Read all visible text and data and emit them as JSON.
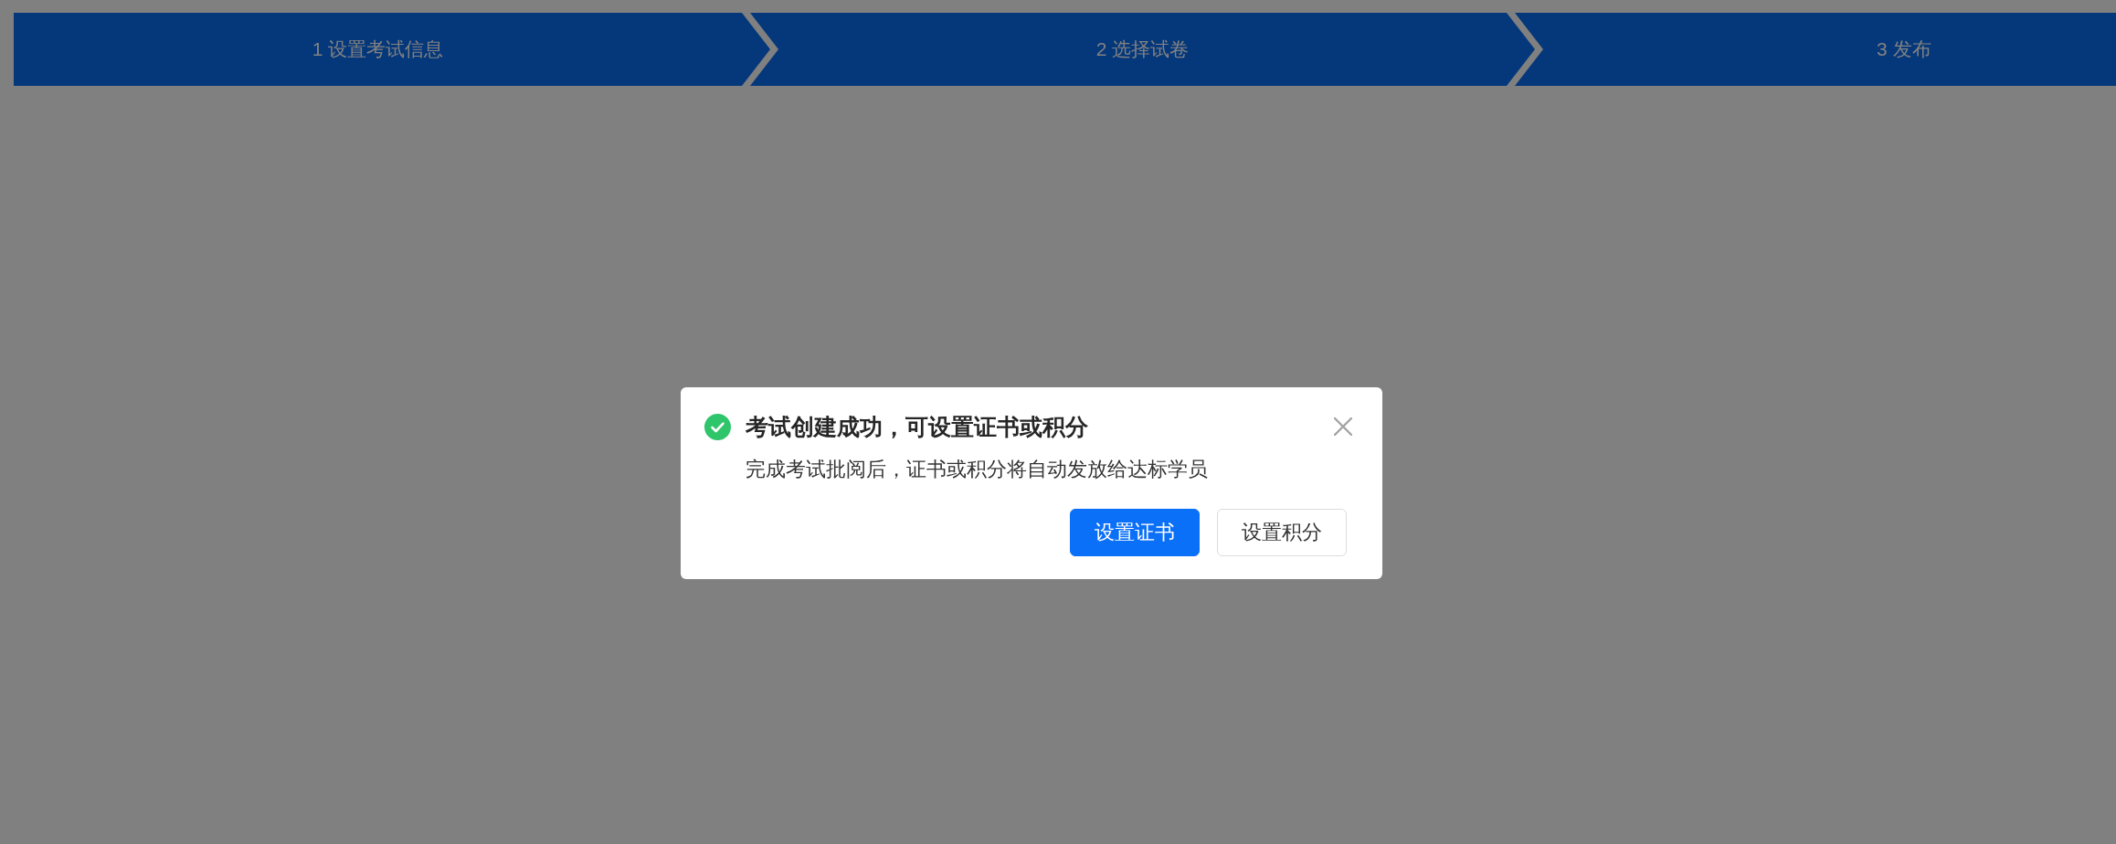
{
  "steps": [
    {
      "label": "1 设置考试信息"
    },
    {
      "label": "2 选择试卷"
    },
    {
      "label": "3 发布"
    }
  ],
  "dialog": {
    "title": "考试创建成功，可设置证书或积分",
    "message": "完成考试批阅后，证书或积分将自动发放给达标学员",
    "buttons": [
      {
        "label": "设置证书",
        "kind": "primary"
      },
      {
        "label": "设置积分",
        "kind": "default"
      }
    ]
  }
}
